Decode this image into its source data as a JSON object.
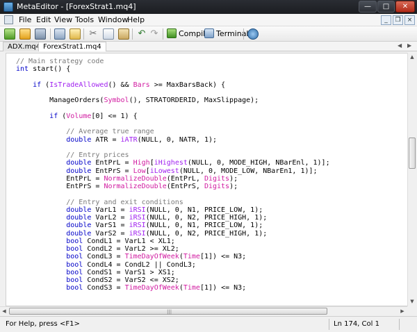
{
  "window": {
    "title": "MetaEditor - [ForexStrat1.mq4]"
  },
  "menu": {
    "items": [
      "File",
      "Edit",
      "View",
      "Tools",
      "Window",
      "Help"
    ]
  },
  "toolbar": {
    "compile_label": "Compile",
    "terminal_label": "Terminal",
    "icons": [
      "new-file-icon",
      "open-folder-icon",
      "save-icon",
      "navigator-icon",
      "book-icon",
      "cut-icon",
      "copy-icon",
      "paste-icon",
      "undo-icon",
      "redo-icon",
      "compile-icon",
      "terminal-icon",
      "help-icon"
    ]
  },
  "tabs": [
    {
      "label": "ADX.mq4",
      "active": false
    },
    {
      "label": "ForexStrat1.mq4",
      "active": true
    }
  ],
  "code": [
    [
      [
        "c",
        "// Main strategy code"
      ]
    ],
    [
      [
        "k",
        "int"
      ],
      [
        "n",
        " start() {"
      ]
    ],
    [
      [
        "n",
        ""
      ]
    ],
    [
      [
        "n",
        "    "
      ],
      [
        "k",
        "if"
      ],
      [
        "n",
        " ("
      ],
      [
        "f",
        "IsTradeAllowed"
      ],
      [
        "n",
        "() && "
      ],
      [
        "s",
        "Bars"
      ],
      [
        "n",
        " >= MaxBarsBack) {"
      ]
    ],
    [
      [
        "n",
        ""
      ]
    ],
    [
      [
        "n",
        "        ManageOrders("
      ],
      [
        "s",
        "Symbol"
      ],
      [
        "n",
        "(), STRATORDERID, MaxSlippage);"
      ]
    ],
    [
      [
        "n",
        ""
      ]
    ],
    [
      [
        "n",
        "        "
      ],
      [
        "k",
        "if"
      ],
      [
        "n",
        " ("
      ],
      [
        "s",
        "Volume"
      ],
      [
        "n",
        "[0] <= 1) {"
      ]
    ],
    [
      [
        "n",
        ""
      ]
    ],
    [
      [
        "n",
        "            "
      ],
      [
        "c",
        "// Average true range"
      ]
    ],
    [
      [
        "n",
        "            "
      ],
      [
        "k",
        "double"
      ],
      [
        "n",
        " ATR = "
      ],
      [
        "f",
        "iATR"
      ],
      [
        "n",
        "(NULL, 0, NATR, 1);"
      ]
    ],
    [
      [
        "n",
        ""
      ]
    ],
    [
      [
        "n",
        "            "
      ],
      [
        "c",
        "// Entry prices"
      ]
    ],
    [
      [
        "n",
        "            "
      ],
      [
        "k",
        "double"
      ],
      [
        "n",
        " EntPrL = "
      ],
      [
        "s",
        "High"
      ],
      [
        "n",
        "["
      ],
      [
        "f",
        "iHighest"
      ],
      [
        "n",
        "(NULL, 0, MODE_HIGH, NBarEnl, 1)];"
      ]
    ],
    [
      [
        "n",
        "            "
      ],
      [
        "k",
        "double"
      ],
      [
        "n",
        " EntPrS = "
      ],
      [
        "s",
        "Low"
      ],
      [
        "n",
        "["
      ],
      [
        "f",
        "iLowest"
      ],
      [
        "n",
        "(NULL, 0, MODE_LOW, NBarEn1, 1)];"
      ]
    ],
    [
      [
        "n",
        "            EntPrL = "
      ],
      [
        "s",
        "NormalizeDouble"
      ],
      [
        "n",
        "(EntPrL, "
      ],
      [
        "s",
        "Digits"
      ],
      [
        "n",
        ");"
      ]
    ],
    [
      [
        "n",
        "            EntPrS = "
      ],
      [
        "s",
        "NormalizeDouble"
      ],
      [
        "n",
        "(EntPrS, "
      ],
      [
        "s",
        "Digits"
      ],
      [
        "n",
        ");"
      ]
    ],
    [
      [
        "n",
        ""
      ]
    ],
    [
      [
        "n",
        "            "
      ],
      [
        "c",
        "// Entry and exit conditions"
      ]
    ],
    [
      [
        "n",
        "            "
      ],
      [
        "k",
        "double"
      ],
      [
        "n",
        " VarL1 = "
      ],
      [
        "f",
        "iRSI"
      ],
      [
        "n",
        "(NULL, 0, N1, PRICE_LOW, 1);"
      ]
    ],
    [
      [
        "n",
        "            "
      ],
      [
        "k",
        "double"
      ],
      [
        "n",
        " VarL2 = "
      ],
      [
        "f",
        "iRSI"
      ],
      [
        "n",
        "(NULL, 0, N2, PRICE_HIGH, 1);"
      ]
    ],
    [
      [
        "n",
        "            "
      ],
      [
        "k",
        "double"
      ],
      [
        "n",
        " VarS1 = "
      ],
      [
        "f",
        "iRSI"
      ],
      [
        "n",
        "(NULL, 0, N1, PRICE_LOW, 1);"
      ]
    ],
    [
      [
        "n",
        "            "
      ],
      [
        "k",
        "double"
      ],
      [
        "n",
        " VarS2 = "
      ],
      [
        "f",
        "iRSI"
      ],
      [
        "n",
        "(NULL, 0, N2, PRICE_HIGH, 1);"
      ]
    ],
    [
      [
        "n",
        "            "
      ],
      [
        "k",
        "bool"
      ],
      [
        "n",
        " CondL1 = VarL1 < XL1;"
      ]
    ],
    [
      [
        "n",
        "            "
      ],
      [
        "k",
        "bool"
      ],
      [
        "n",
        " CondL2 = VarL2 >= XL2;"
      ]
    ],
    [
      [
        "n",
        "            "
      ],
      [
        "k",
        "bool"
      ],
      [
        "n",
        " CondL3 = "
      ],
      [
        "s",
        "TimeDayOfWeek"
      ],
      [
        "n",
        "("
      ],
      [
        "s",
        "Time"
      ],
      [
        "n",
        "[1]) <= N3;"
      ]
    ],
    [
      [
        "n",
        "            "
      ],
      [
        "k",
        "bool"
      ],
      [
        "n",
        " CondL4 = CondL2 || CondL3;"
      ]
    ],
    [
      [
        "n",
        "            "
      ],
      [
        "k",
        "bool"
      ],
      [
        "n",
        " CondS1 = VarS1 > XS1;"
      ]
    ],
    [
      [
        "n",
        "            "
      ],
      [
        "k",
        "bool"
      ],
      [
        "n",
        " CondS2 = VarS2 <= XS2;"
      ]
    ],
    [
      [
        "n",
        "            "
      ],
      [
        "k",
        "bool"
      ],
      [
        "n",
        " CondS3 = "
      ],
      [
        "s",
        "TimeDayOfWeek"
      ],
      [
        "n",
        "("
      ],
      [
        "s",
        "Time"
      ],
      [
        "n",
        "[1]) <= N3;"
      ]
    ]
  ],
  "status": {
    "help_text": "For Help, press <F1>",
    "position": "Ln 174, Col 1"
  }
}
